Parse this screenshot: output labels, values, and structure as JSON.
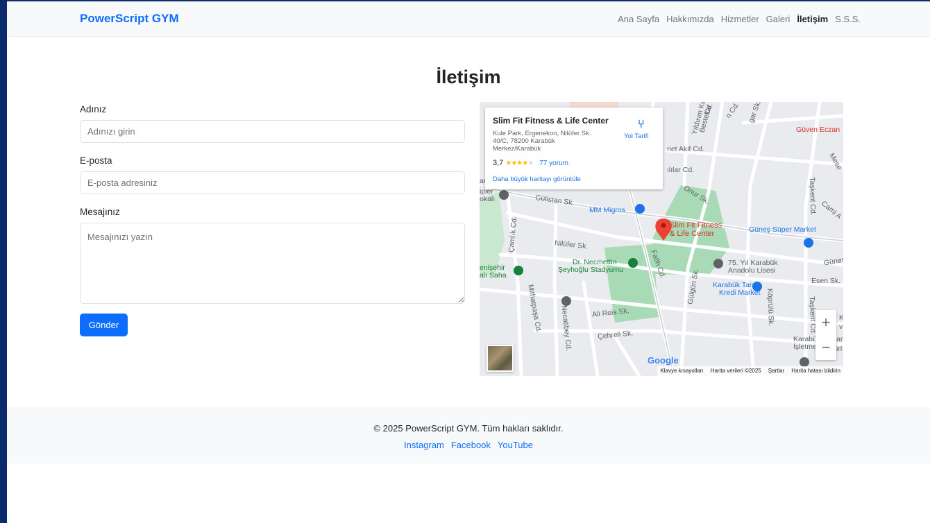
{
  "brand": "PowerScript GYM",
  "nav": {
    "items": [
      "Ana Sayfa",
      "Hakkımızda",
      "Hizmetler",
      "Galeri",
      "İletişim",
      "S.S.S."
    ],
    "active": "İletişim"
  },
  "page_title": "İletişim",
  "form": {
    "name_label": "Adınız",
    "name_placeholder": "Adınızı girin",
    "email_label": "E-posta",
    "email_placeholder": "E-posta adresiniz",
    "message_label": "Mesajınız",
    "message_placeholder": "Mesajınızı yazın",
    "submit_label": "Gönder"
  },
  "map": {
    "place_name": "Slim Fit Fitness & Life Center",
    "address": "Kule Park, Ergenekon, Nilüfer Sk. 40/C, 78200 Karabük Merkez/Karabük",
    "directions_label": "Yol Tarifi",
    "rating": "3,7",
    "stars": "★★★★",
    "stars_off": "★",
    "reviews": "77 yorum",
    "larger_map": "Daha büyük haritayı görüntüle",
    "marker_label_line1": "Slim Fit Fitness",
    "marker_label_line2": "& Life Center",
    "labels": {
      "gulistan": "Gülistan Sk.",
      "mm_migros": "MM Migros",
      "nilufer": "Nilüfer Sk.",
      "stadium1": "Dr. Necmettin",
      "stadium2": "Şeyhoğlu Stadyumu",
      "ali_reis": "Ali Reis Sk.",
      "cehreli": "Çehreli Sk.",
      "fatih": "Fatih Cd.",
      "necatibey": "Necatibey Cd.",
      "mithat": "Mithatpaşa Cd.",
      "camlik": "Çamlık Cd.",
      "guven": "Güven Eczan",
      "mehmet_akif": "net Akif Cd.",
      "kartallar": "ılılar Cd.",
      "onur": "Onur Sk.",
      "taskent": "Taşkent Cd.",
      "taskent2": "Taşkent Cd.",
      "gunes": "Güneş Süper Market",
      "lise1": "75. Yıl Karabük",
      "lise2": "Anadolu Lisesi",
      "bank1": "Karabük Tarım",
      "bank2": "Kredi Market",
      "esen": "Esen Sk.",
      "koprulu": "Köprülü Sk.",
      "gulgun": "Gülgün Sk.",
      "yildirim": "Yıldırım Ke",
      "bestekar": "Bestekar",
      "cami": "Cami A",
      "gunes2": "Güneş",
      "genisehir1": "enişehir",
      "genisehir2": "alı Saha",
      "ipler1": "ipler",
      "ipler2": "okalı",
      "karabuk_isl1": "Karabü",
      "karabuk_isl2": "İşletme",
      "k_frag": "K",
      "v_frag": "v",
      "ar_frag": "ar",
      "irl_frag": "irl",
      "mese_frag": "Mese",
      "sk_frag1": "Cd.",
      "sk_frag2": "gar Sk.",
      "sk_frag3": "n Cd.",
      "sk_frag4": "ar Sk."
    },
    "google": "Google",
    "attribution": [
      "Klavye kısayolları",
      "Harita verileri ©2025",
      "Şartlar",
      "Harita hatası bildirin"
    ]
  },
  "footer": {
    "copyright": "© 2025 PowerScript GYM. Tüm hakları saklıdır.",
    "links": [
      "Instagram",
      "Facebook",
      "YouTube"
    ]
  },
  "colors": {
    "primary": "#0d6efd",
    "navbar_bg": "#f8f9fa",
    "outer_bg": "#0b2a6b"
  }
}
